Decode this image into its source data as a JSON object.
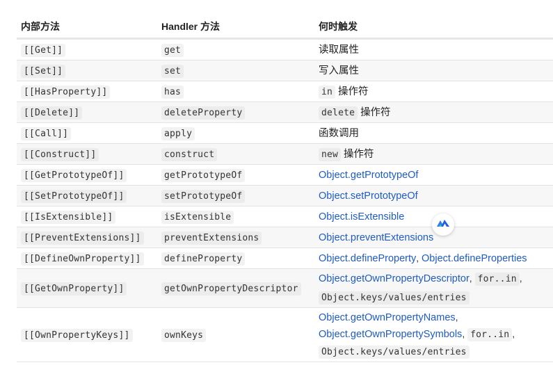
{
  "headers": {
    "col1": "内部方法",
    "col2": "Handler 方法",
    "col3": "何时触发"
  },
  "rows": [
    {
      "internal": "[[Get]]",
      "handler": "get",
      "trigger_text": "读取属性"
    },
    {
      "internal": "[[Set]]",
      "handler": "set",
      "trigger_text": "写入属性"
    },
    {
      "internal": "[[HasProperty]]",
      "handler": "has",
      "trigger_code": "in",
      "trigger_text": "操作符"
    },
    {
      "internal": "[[Delete]]",
      "handler": "deleteProperty",
      "trigger_code": "delete",
      "trigger_text": "操作符"
    },
    {
      "internal": "[[Call]]",
      "handler": "apply",
      "trigger_text": "函数调用"
    },
    {
      "internal": "[[Construct]]",
      "handler": "construct",
      "trigger_code": "new",
      "trigger_text": "操作符"
    },
    {
      "internal": "[[GetPrototypeOf]]",
      "handler": "getPrototypeOf",
      "trigger_link": "Object.getPrototypeOf"
    },
    {
      "internal": "[[SetPrototypeOf]]",
      "handler": "setPrototypeOf",
      "trigger_link": "Object.setPrototypeOf"
    },
    {
      "internal": "[[IsExtensible]]",
      "handler": "isExtensible",
      "trigger_link": "Object.isExtensible"
    },
    {
      "internal": "[[PreventExtensions]]",
      "handler": "preventExtensions",
      "trigger_link": "Object.preventExtensions"
    },
    {
      "internal": "[[DefineOwnProperty]]",
      "handler": "defineProperty",
      "trigger_link": "Object.defineProperty",
      "trigger_link2": "Object.defineProperties"
    },
    {
      "internal": "[[GetOwnProperty]]",
      "handler": "getOwnPropertyDescriptor",
      "trigger_link": "Object.getOwnPropertyDescriptor",
      "trigger_code": "for..in",
      "trigger_code2": "Object.keys/values/entries"
    },
    {
      "internal": "[[OwnPropertyKeys]]",
      "handler": "ownKeys",
      "trigger_link": "Object.getOwnPropertyNames",
      "trigger_link2": "Object.getOwnPropertySymbols",
      "trigger_code": "for..in",
      "trigger_code2": "Object.keys/values/entries"
    }
  ],
  "separators": {
    "comma": ","
  },
  "colors": {
    "link": "#1e5bc6",
    "row_alt": "#f7f7f7",
    "code_bg": "#f2f2f2"
  },
  "floating_badge": {
    "icon": "translate-logo-icon"
  }
}
